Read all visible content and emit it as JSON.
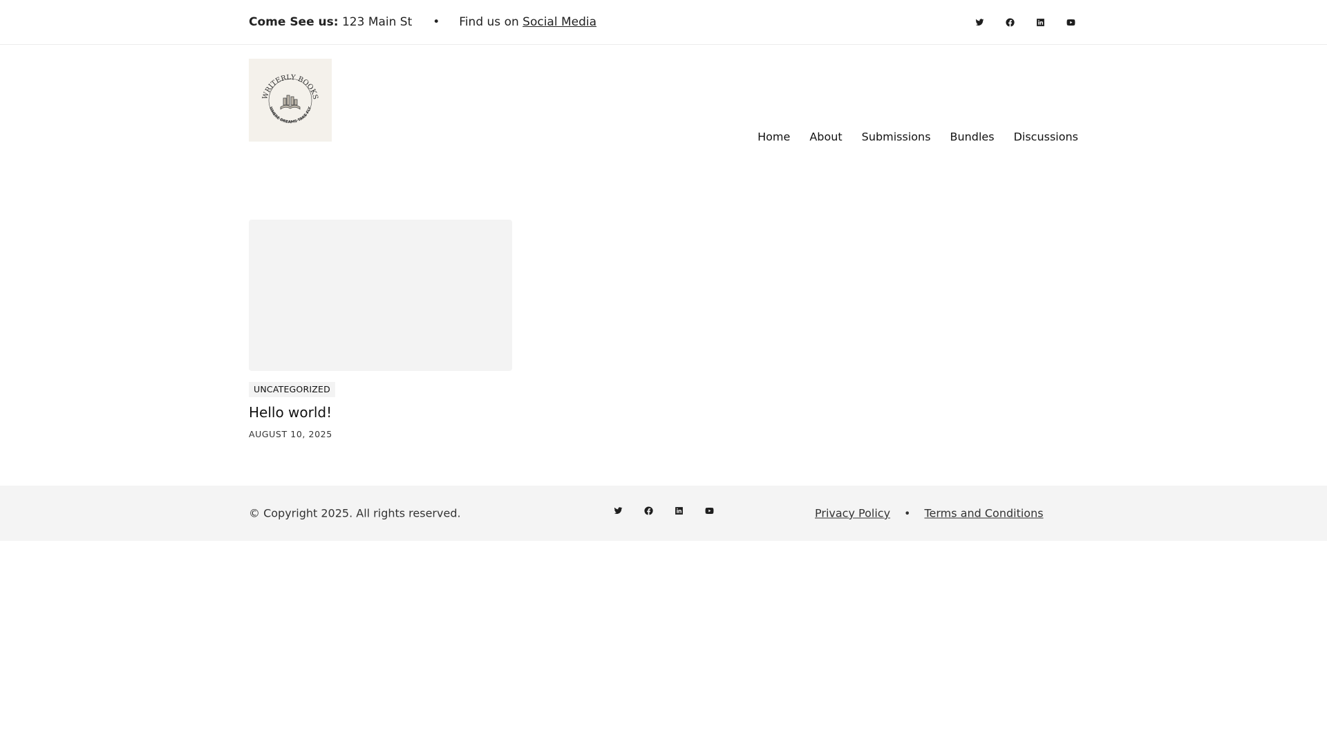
{
  "topbar": {
    "address_label": "Come See us:",
    "address_value": "123 Main St",
    "separator": "•",
    "find_prefix": "Find us on",
    "find_link": "Social Media",
    "social_icons": [
      "twitter-icon",
      "facebook-icon",
      "linkedin-icon",
      "youtube-icon"
    ]
  },
  "header": {
    "logo_title": "WRITERLY BOOKS",
    "logo_tagline": "WHERE DREAMS TAKE FLY",
    "nav": [
      {
        "label": "Home"
      },
      {
        "label": "About"
      },
      {
        "label": "Submissions"
      },
      {
        "label": "Bundles"
      },
      {
        "label": "Discussions"
      }
    ]
  },
  "post": {
    "category": "UNCATEGORIZED",
    "title": "Hello world!",
    "date": "AUGUST 10, 2025"
  },
  "footer": {
    "copyright": "© Copyright 2025. All rights reserved.",
    "separator": "•",
    "privacy": "Privacy Policy",
    "terms": "Terms and Conditions",
    "social_icons": [
      "twitter-icon",
      "facebook-icon",
      "linkedin-icon",
      "youtube-icon"
    ]
  },
  "colors": {
    "text": "#1e1e1e",
    "surface": "#f4f4f4",
    "logo_bg": "#f4f1eb"
  }
}
